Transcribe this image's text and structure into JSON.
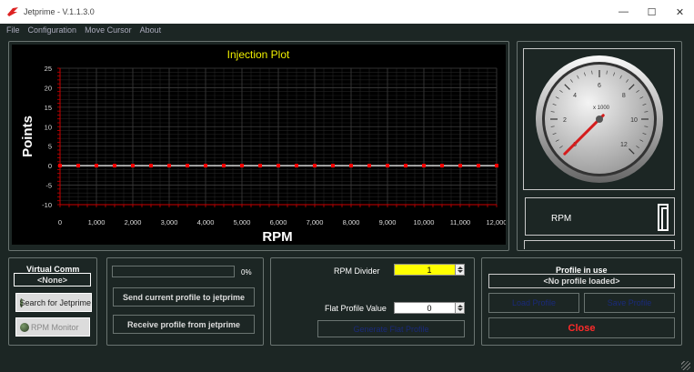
{
  "window": {
    "title": "Jetprime - V.1.1.3.0"
  },
  "menu": [
    "File",
    "Configuration",
    "Move Cursor",
    "About"
  ],
  "chart_data": {
    "type": "line",
    "title": "Injection Plot",
    "xlabel": "RPM",
    "ylabel": "Points",
    "xlim": [
      0,
      12000
    ],
    "ylim": [
      -10,
      25
    ],
    "xticks": [
      "0",
      "1,000",
      "2,000",
      "3,000",
      "4,000",
      "5,000",
      "6,000",
      "7,000",
      "8,000",
      "9,000",
      "10,000",
      "11,000",
      "12,000"
    ],
    "yticks": [
      "25",
      "20",
      "15",
      "10",
      "5",
      "0",
      "-5",
      "-10"
    ],
    "series": [
      {
        "x": [
          0,
          250,
          500,
          750,
          1000,
          1250,
          1500,
          1750,
          2000,
          2250,
          2500,
          2750,
          3000,
          3250,
          3500,
          3750,
          4000,
          4250,
          4500,
          4750,
          5000,
          5250,
          5500,
          5750,
          6000,
          6250,
          6500,
          6750,
          7000,
          7250,
          7500,
          7750,
          8000,
          8250,
          8500,
          8750,
          9000,
          9250,
          9500,
          9750,
          10000,
          10250,
          10500,
          10750,
          11000,
          11250,
          11500,
          11750,
          12000
        ],
        "y": [
          0,
          0,
          0,
          0,
          0,
          0,
          0,
          0,
          0,
          0,
          0,
          0,
          0,
          0,
          0,
          0,
          0,
          0,
          0,
          0,
          0,
          0,
          0,
          0,
          0,
          0,
          0,
          0,
          0,
          0,
          0,
          0,
          0,
          0,
          0,
          0,
          0,
          0,
          0,
          0,
          0,
          0,
          0,
          0,
          0,
          0,
          0,
          0,
          0
        ]
      }
    ],
    "grid": true
  },
  "gauge": {
    "unit_label": "x 1000",
    "ticks": [
      "0",
      "2",
      "4",
      "6",
      "8",
      "10",
      "12"
    ]
  },
  "rpm_display": {
    "label": "RPM",
    "value": "0"
  },
  "virtual_comm": {
    "title": "Virtual Comm",
    "port": "<None>",
    "search_label": "Search for Jetprime",
    "monitor_label": "RPM Monitor"
  },
  "transfer": {
    "progress_percent": 0,
    "progress_text": "0%",
    "send_label": "Send current profile to jetprime",
    "receive_label": "Receive profile from jetprime"
  },
  "settings": {
    "rpm_divider_label": "RPM Divider",
    "rpm_divider_value": "1",
    "flat_profile_label": "Flat Profile Value",
    "flat_profile_value": "0",
    "generate_label": "Generate Flat Profile"
  },
  "profile": {
    "title": "Profile in use",
    "name": "<No profile loaded>",
    "load_label": "Load Profile",
    "save_label": "Save Profile",
    "close_label": "Close"
  },
  "colors": {
    "accent_yellow": "#f0f000",
    "close_red": "#ff2a2a",
    "series": "#ffffff",
    "points": "#ff0000"
  }
}
